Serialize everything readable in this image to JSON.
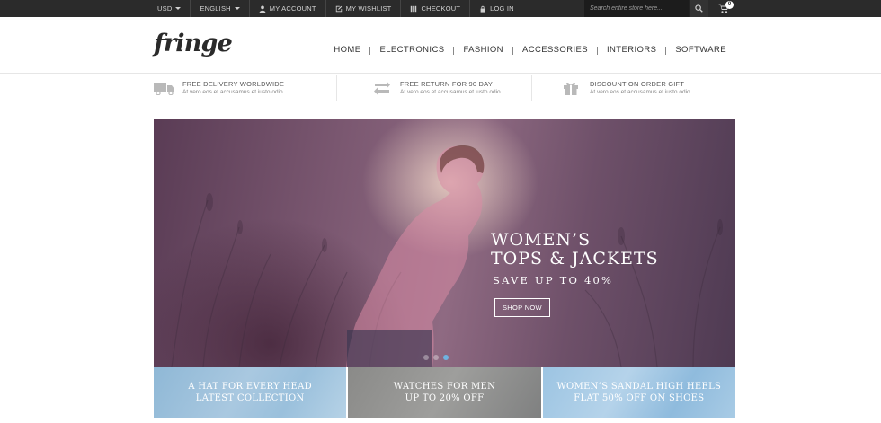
{
  "topbar": {
    "currency": "USD",
    "language": "ENGLISH",
    "links": [
      {
        "label": "MY ACCOUNT",
        "icon": "user-icon"
      },
      {
        "label": "MY WISHLIST",
        "icon": "edit-icon"
      },
      {
        "label": "CHECKOUT",
        "icon": "checkout-icon"
      },
      {
        "label": "LOG IN",
        "icon": "lock-icon"
      }
    ],
    "search_placeholder": "Search entire store here...",
    "cart_count": "0"
  },
  "header": {
    "logo": "fringe",
    "nav": [
      "HOME",
      "ELECTRONICS",
      "FASHION",
      "ACCESSORIES",
      "INTERIORS",
      "SOFTWARE"
    ]
  },
  "features": [
    {
      "title": "FREE DELIVERY WORLDWIDE",
      "subtitle": "At vero eos et accusamus et iusto odio",
      "icon": "truck-icon"
    },
    {
      "title": "FREE RETURN FOR 90 DAY",
      "subtitle": "At vero eos et accusamus et iusto odio",
      "icon": "return-icon"
    },
    {
      "title": "DISCOUNT ON ORDER GIFT",
      "subtitle": "At vero eos et accusamus et iusto odio",
      "icon": "gift-icon"
    }
  ],
  "hero": {
    "line1": "WOMEN’S",
    "line2": "TOPS & JACKETS",
    "subtitle": "SAVE UP TO 40%",
    "button": "SHOP NOW"
  },
  "promos": [
    {
      "line1": "A HAT FOR EVERY HEAD",
      "line2": "LATEST COLLECTION"
    },
    {
      "line1": "WATCHES FOR MEN",
      "line2": "UP TO 20% OFF"
    },
    {
      "line1": "WOMEN’S SANDAL HIGH HEELS",
      "line2": "FLAT 50% OFF ON SHOES"
    }
  ],
  "colors": {
    "topbar_bg": "#2b2b2b",
    "accent_dot": "#6fb3e0"
  }
}
